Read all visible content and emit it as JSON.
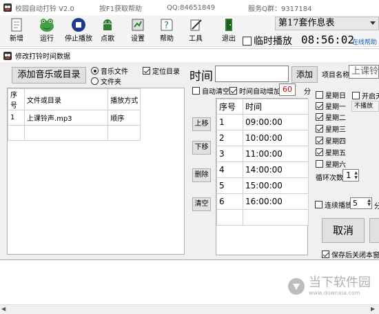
{
  "title_bar": {
    "app_title": "校园自动打铃 V2.0",
    "help_hint": "按F1获取帮助",
    "qq": "QQ:84651849",
    "service_qq": "服务Q群：9317184"
  },
  "toolbar": {
    "buttons": [
      {
        "label": "新增",
        "icon": "new-doc-icon"
      },
      {
        "label": "运行",
        "icon": "frog-icon"
      },
      {
        "label": "停止播放",
        "icon": "stop-icon"
      },
      {
        "label": "点歌",
        "icon": "android-icon"
      },
      {
        "label": "设置",
        "icon": "settings-icon"
      },
      {
        "label": "帮助",
        "icon": "help-icon"
      },
      {
        "label": "工具",
        "icon": "tool-icon"
      },
      {
        "label": "退出",
        "icon": "exit-icon"
      }
    ],
    "schedule_selected": "第17套作息表",
    "temp_play_label": "临时播放",
    "clock": "08:56:02",
    "online_help": "在线帮助"
  },
  "dialog": {
    "title": "修改打铃时间数据",
    "add_music_button": "添加音乐或目录",
    "radio_music_file": "音乐文件",
    "radio_folder": "文件夹",
    "locate_dir_label": "定位目录",
    "file_table": {
      "headers": [
        "序号",
        "文件或目录",
        "播放方式"
      ],
      "rows": [
        {
          "index": "1",
          "file": "上课铃声.mp3",
          "mode": "顺序"
        }
      ]
    },
    "time_label": "时间",
    "time_input": "",
    "add_button": "添加",
    "auto_clear_label": "自动清空",
    "auto_increase_label": "时间自动增加",
    "increase_value": "60",
    "increase_unit": "分",
    "move_up": "上移",
    "move_down": "下移",
    "delete": "删除",
    "clear": "清空",
    "time_table": {
      "headers": [
        "序号",
        "时间"
      ],
      "rows": [
        {
          "index": "1",
          "time": "09:00:00"
        },
        {
          "index": "2",
          "time": "10:00:00"
        },
        {
          "index": "3",
          "time": "11:00:00"
        },
        {
          "index": "4",
          "time": "14:00:00"
        },
        {
          "index": "5",
          "time": "15:00:00"
        },
        {
          "index": "6",
          "time": "16:00:00"
        }
      ]
    },
    "project_name_label": "项目名称",
    "project_name_value": "上课铃",
    "weekdays": [
      {
        "label": "星期日",
        "checked": false
      },
      {
        "label": "星期一",
        "checked": true
      },
      {
        "label": "星期二",
        "checked": true
      },
      {
        "label": "星期三",
        "checked": true
      },
      {
        "label": "星期四",
        "checked": true
      },
      {
        "label": "星期五",
        "checked": true
      },
      {
        "label": "星期六",
        "checked": false
      }
    ],
    "enable_label": "开启天",
    "no_play_label": "不播放",
    "loop_count_label": "循环次数",
    "loop_count_value": "1",
    "continuous_play_label": "连续播放",
    "continuous_value": "5",
    "continuous_unit": "分",
    "cancel_button": "取消",
    "save_close_label": "保存后关闭本窗口"
  },
  "watermark": {
    "text_cn": "当下软件园",
    "text_url": "www.downxia.com"
  },
  "colors": {
    "accent_blue": "#1565c0",
    "red_value": "#cc0000",
    "dialog_bg": "#f0f0f0",
    "window_bg": "#ffffff"
  }
}
